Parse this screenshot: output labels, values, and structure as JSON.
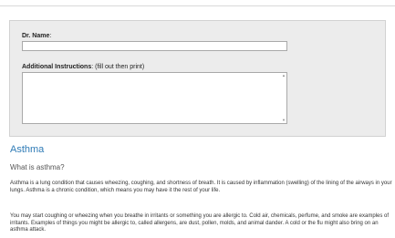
{
  "form": {
    "dr_name_label": "Dr. Name",
    "dr_name_value": "",
    "instructions_label": "Additional Instructions",
    "instructions_hint": ": (fill out then print)",
    "instructions_value": ""
  },
  "article": {
    "title": "Asthma",
    "question": "What is asthma?",
    "paragraph1": "Asthma is a lung condition that causes wheezing, coughing, and shortness of breath. It is caused by inflammation (swelling) of the lining of the airways in your lungs. Asthma is a chronic condition, which means you may have it the rest of your life.",
    "paragraph2": "You may start coughing or wheezing when you breathe in irritants or something you are allergic to. Cold air, chemicals, perfume, and smoke are examples of irritants. Examples of things you might be allergic to, called allergens, are dust, pollen, molds, and animal dander. A cold or the flu might also bring on an asthma attack."
  },
  "icons": {
    "scroll_up": "scroll-up-arrow",
    "scroll_down": "scroll-down-arrow"
  },
  "colors": {
    "panel_background": "#ececec",
    "title_blue": "#2f7bb6"
  }
}
